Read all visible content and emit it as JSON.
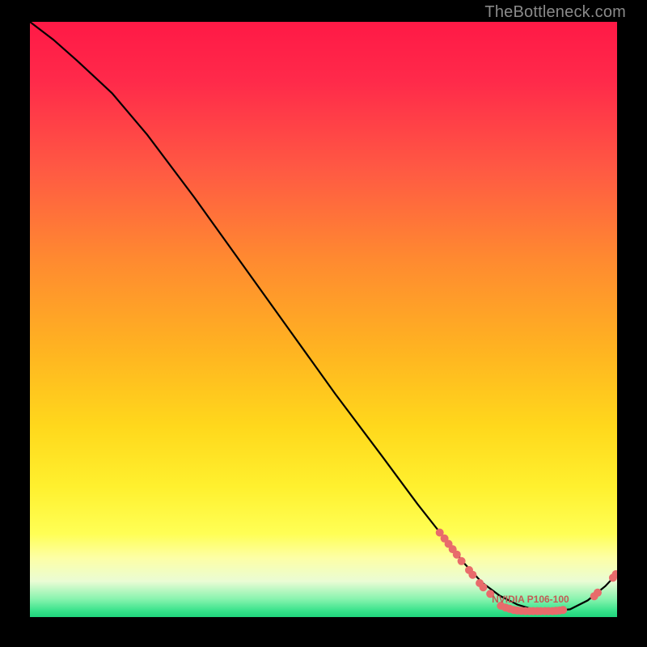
{
  "watermark": "TheBottleneck.com",
  "label": "NVIDIA P106-100",
  "chart_data": {
    "type": "line",
    "title": "",
    "xlabel": "",
    "ylabel": "",
    "xlim": [
      0,
      100
    ],
    "ylim": [
      0,
      100
    ],
    "series": [
      {
        "name": "curve",
        "x": [
          0,
          4,
          8,
          14,
          20,
          28,
          36,
          44,
          52,
          60,
          66,
          70,
          74,
          77,
          80,
          83,
          86,
          89,
          92,
          95,
          98,
          100
        ],
        "y": [
          100,
          97,
          93.5,
          88,
          81,
          70.5,
          59.5,
          48.5,
          37.5,
          27,
          19,
          14,
          9,
          5.8,
          3.6,
          2.1,
          1.2,
          1.0,
          1.3,
          2.8,
          5.2,
          7.3
        ]
      }
    ],
    "points": [
      {
        "x": 69.8,
        "y": 14.2
      },
      {
        "x": 70.6,
        "y": 13.2
      },
      {
        "x": 71.3,
        "y": 12.3
      },
      {
        "x": 72.0,
        "y": 11.4
      },
      {
        "x": 72.7,
        "y": 10.5
      },
      {
        "x": 73.5,
        "y": 9.4
      },
      {
        "x": 74.8,
        "y": 7.9
      },
      {
        "x": 75.4,
        "y": 7.1
      },
      {
        "x": 76.6,
        "y": 5.7
      },
      {
        "x": 77.2,
        "y": 5.0
      },
      {
        "x": 78.4,
        "y": 3.9
      },
      {
        "x": 80.2,
        "y": 1.9
      },
      {
        "x": 81.0,
        "y": 1.6
      },
      {
        "x": 81.7,
        "y": 1.4
      },
      {
        "x": 82.4,
        "y": 1.2
      },
      {
        "x": 83.0,
        "y": 1.1
      },
      {
        "x": 83.7,
        "y": 1.05
      },
      {
        "x": 84.4,
        "y": 1.0
      },
      {
        "x": 85.1,
        "y": 1.0
      },
      {
        "x": 85.7,
        "y": 1.0
      },
      {
        "x": 86.4,
        "y": 1.0
      },
      {
        "x": 87.0,
        "y": 1.0
      },
      {
        "x": 87.7,
        "y": 1.0
      },
      {
        "x": 88.3,
        "y": 1.0
      },
      {
        "x": 89.0,
        "y": 1.0
      },
      {
        "x": 89.6,
        "y": 1.05
      },
      {
        "x": 90.2,
        "y": 1.1
      },
      {
        "x": 90.8,
        "y": 1.2
      },
      {
        "x": 96.1,
        "y": 3.5
      },
      {
        "x": 96.7,
        "y": 4.1
      },
      {
        "x": 99.3,
        "y": 6.6
      },
      {
        "x": 99.8,
        "y": 7.2
      }
    ],
    "label_pos": {
      "x": 85,
      "y": 2.8
    }
  }
}
